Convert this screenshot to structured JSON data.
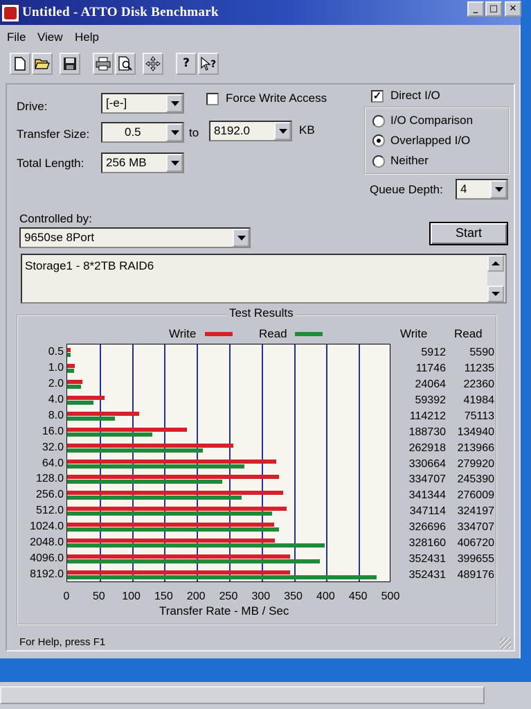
{
  "window": {
    "title": "Untitled - ATTO Disk Benchmark",
    "controls": {
      "minimize": "_",
      "maximize": "□",
      "close": "✕"
    }
  },
  "menu": [
    "File",
    "View",
    "Help"
  ],
  "toolbar": {
    "icons": [
      "new-document-icon",
      "open-folder-icon",
      "save-disk-icon",
      "print-icon",
      "print-preview-icon",
      "move-icon",
      "help-icon",
      "context-help-icon"
    ]
  },
  "form": {
    "drive_label": "Drive:",
    "drive_value": "[-e-]",
    "force_write_label": "Force Write Access",
    "force_write_checked": false,
    "direct_io_label": "Direct I/O",
    "direct_io_checked": true,
    "transfer_size_label": "Transfer Size:",
    "transfer_from": "0.5",
    "to_label": "to",
    "transfer_to": "8192.0",
    "kb_label": "KB",
    "total_length_label": "Total Length:",
    "total_length_value": "256 MB",
    "io_options": [
      {
        "label": "I/O Comparison",
        "selected": false
      },
      {
        "label": "Overlapped I/O",
        "selected": true
      },
      {
        "label": "Neither",
        "selected": false
      }
    ],
    "queue_depth_label": "Queue Depth:",
    "queue_depth_value": "4",
    "controlled_by_label": "Controlled by:",
    "controlled_by_value": "9650se 8Port",
    "start_label": "Start",
    "description": "Storage1 - 8*2TB RAID6"
  },
  "results": {
    "title": "Test Results",
    "legend_write": "Write",
    "legend_read": "Read",
    "col_write": "Write",
    "col_read": "Read",
    "write_color": "#d8202a",
    "read_color": "#1e8a3a"
  },
  "chart_data": {
    "type": "bar",
    "orientation": "horizontal",
    "categories": [
      "0.5",
      "1.0",
      "2.0",
      "4.0",
      "8.0",
      "16.0",
      "32.0",
      "64.0",
      "128.0",
      "256.0",
      "512.0",
      "1024.0",
      "2048.0",
      "4096.0",
      "8192.0"
    ],
    "series": [
      {
        "name": "Write",
        "values": [
          5912,
          11746,
          24064,
          59392,
          114212,
          188730,
          262918,
          330664,
          334707,
          341344,
          347114,
          326696,
          328160,
          352431,
          352431
        ]
      },
      {
        "name": "Read",
        "values": [
          5590,
          11235,
          22360,
          41984,
          75113,
          134940,
          213966,
          279920,
          245390,
          276009,
          324197,
          334707,
          406720,
          399655,
          489176
        ]
      }
    ],
    "value_units": "KB/sec",
    "xlabel": "Transfer Rate - MB / Sec",
    "xticks": [
      "0",
      "50",
      "100",
      "150",
      "200",
      "250",
      "300",
      "350",
      "400",
      "450",
      "500"
    ],
    "xlim": [
      0,
      500
    ],
    "legend": "top"
  },
  "status": {
    "help_text": "For Help, press F1"
  }
}
